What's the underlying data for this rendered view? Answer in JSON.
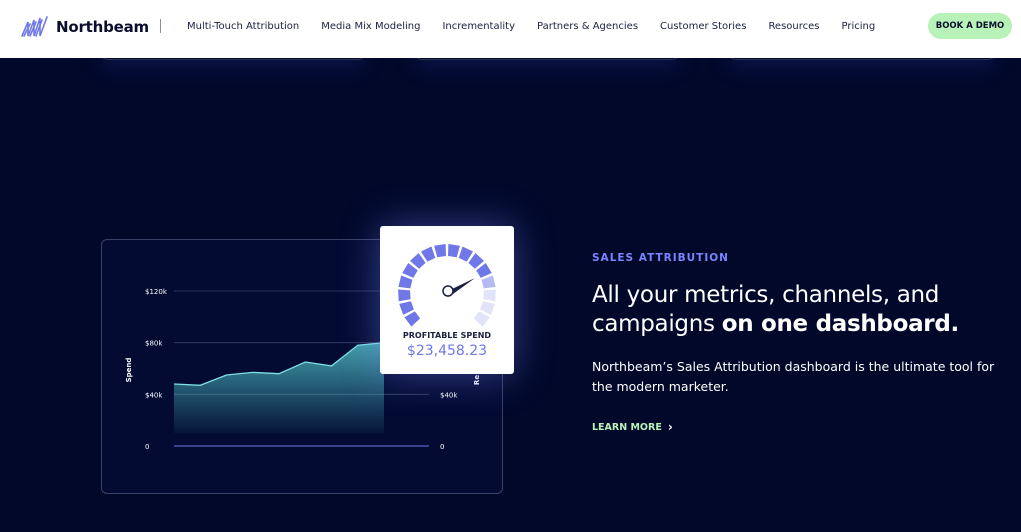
{
  "nav": {
    "logo_text": "Northbeam",
    "links": [
      "Multi-Touch Attribution",
      "Media Mix Modeling",
      "Incrementality",
      "Partners & Agencies",
      "Customer Stories",
      "Resources",
      "Pricing"
    ],
    "cta": "BOOK A DEMO"
  },
  "chart": {
    "y_ticks": [
      "$120k",
      "$80k",
      "$40k",
      "0"
    ],
    "y_ticks_right": [
      "$40k",
      "0"
    ],
    "ylabel": "Spend",
    "ylabel_right": "Re"
  },
  "gauge": {
    "label": "PROFITABLE SPEND",
    "value": "$23,458.23"
  },
  "content": {
    "eyebrow": "SALES ATTRIBUTION",
    "headline_1": "All your metrics, channels, and",
    "headline_2": "campaigns ",
    "headline_bold": "on one dashboard.",
    "description": "Northbeam’s Sales Attribution dashboard is the ultimate tool for the modern marketer.",
    "learn_more": "LEARN MORE"
  },
  "colors": {
    "background": "#01082a",
    "accent": "#7a84ff",
    "cta_green": "#b9f2b9"
  },
  "chart_data": {
    "type": "area",
    "x": [
      1,
      2,
      3,
      4,
      5,
      6,
      7,
      8,
      9
    ],
    "values": [
      48,
      47,
      55,
      57,
      56,
      65,
      62,
      78,
      80
    ],
    "ylabel": "Spend",
    "ylim": [
      0,
      120
    ],
    "y_tick_labels": [
      "0",
      "$40k",
      "$80k",
      "$120k"
    ]
  }
}
